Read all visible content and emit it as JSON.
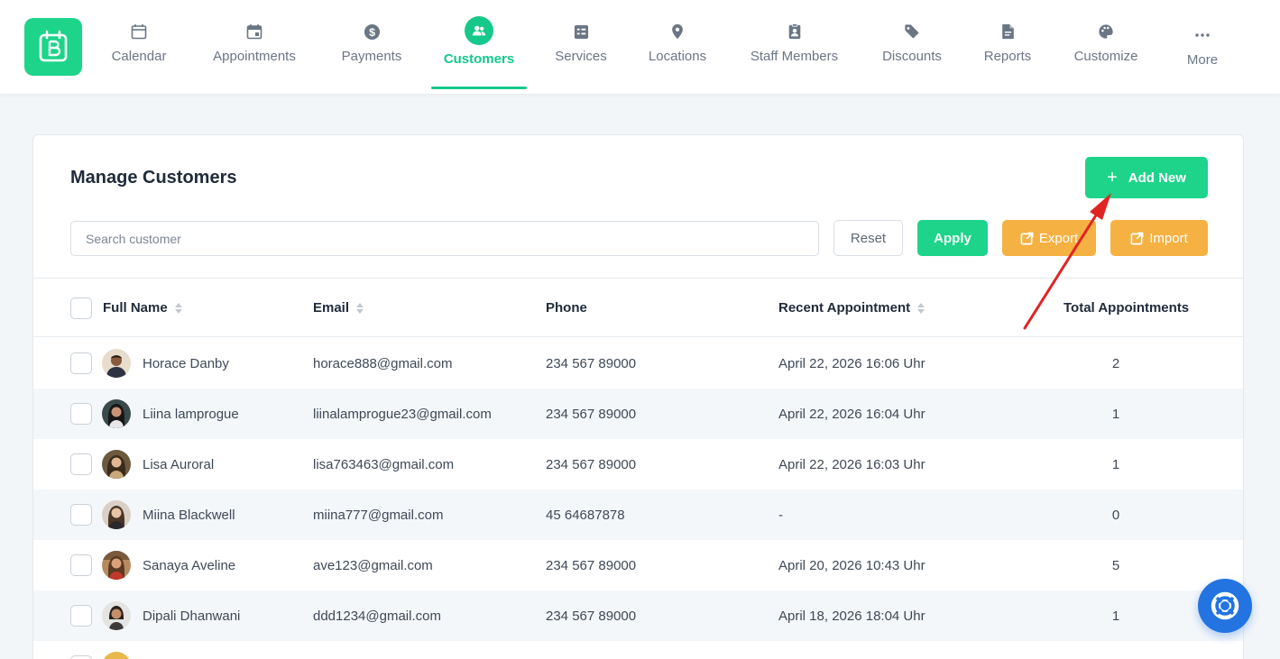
{
  "nav": {
    "items": [
      {
        "label": "Calendar",
        "icon": "calendar-icon"
      },
      {
        "label": "Appointments",
        "icon": "calendar-check-icon"
      },
      {
        "label": "Payments",
        "icon": "dollar-icon"
      },
      {
        "label": "Customers",
        "icon": "users-icon"
      },
      {
        "label": "Services",
        "icon": "list-icon"
      },
      {
        "label": "Locations",
        "icon": "location-pin-icon"
      },
      {
        "label": "Staff Members",
        "icon": "id-badge-icon"
      },
      {
        "label": "Discounts",
        "icon": "tag-icon"
      },
      {
        "label": "Reports",
        "icon": "file-icon"
      },
      {
        "label": "Customize",
        "icon": "palette-icon"
      },
      {
        "label": "More",
        "icon": "more-dots-icon"
      }
    ],
    "active": "Customers",
    "accent_color": "#16c98b"
  },
  "page": {
    "title": "Manage Customers",
    "add_new_label": "Add New",
    "search_placeholder": "Search customer",
    "reset_label": "Reset",
    "apply_label": "Apply",
    "export_label": "Export",
    "import_label": "Import"
  },
  "table": {
    "columns": {
      "full_name": "Full Name",
      "email": "Email",
      "phone": "Phone",
      "recent_appointment": "Recent Appointment",
      "total_appointments": "Total Appointments"
    },
    "rows": [
      {
        "name": "Horace Danby",
        "email": "horace888@gmail.com",
        "phone": "234 567 89000",
        "recent": "April 22, 2026 16:06 Uhr",
        "total": "2"
      },
      {
        "name": "Liina lamprogue",
        "email": "liinalamprogue23@gmail.com",
        "phone": "234 567 89000",
        "recent": "April 22, 2026 16:04 Uhr",
        "total": "1"
      },
      {
        "name": "Lisa Auroral",
        "email": "lisa763463@gmail.com",
        "phone": "234 567 89000",
        "recent": "April 22, 2026 16:03 Uhr",
        "total": "1"
      },
      {
        "name": "Miina Blackwell",
        "email": "miina777@gmail.com",
        "phone": "45 64687878",
        "recent": "-",
        "total": "0"
      },
      {
        "name": "Sanaya Aveline",
        "email": "ave123@gmail.com",
        "phone": "234 567 89000",
        "recent": "April 20, 2026 10:43 Uhr",
        "total": "5"
      },
      {
        "name": "Dipali Dhanwani",
        "email": "ddd1234@gmail.com",
        "phone": "234 567 89000",
        "recent": "April 18, 2026 18:04 Uhr",
        "total": "1"
      }
    ]
  },
  "colors": {
    "primary_green": "#1dd48a",
    "orange": "#f5b142",
    "help_blue": "#2374e1",
    "annotation_red": "#e02424"
  }
}
